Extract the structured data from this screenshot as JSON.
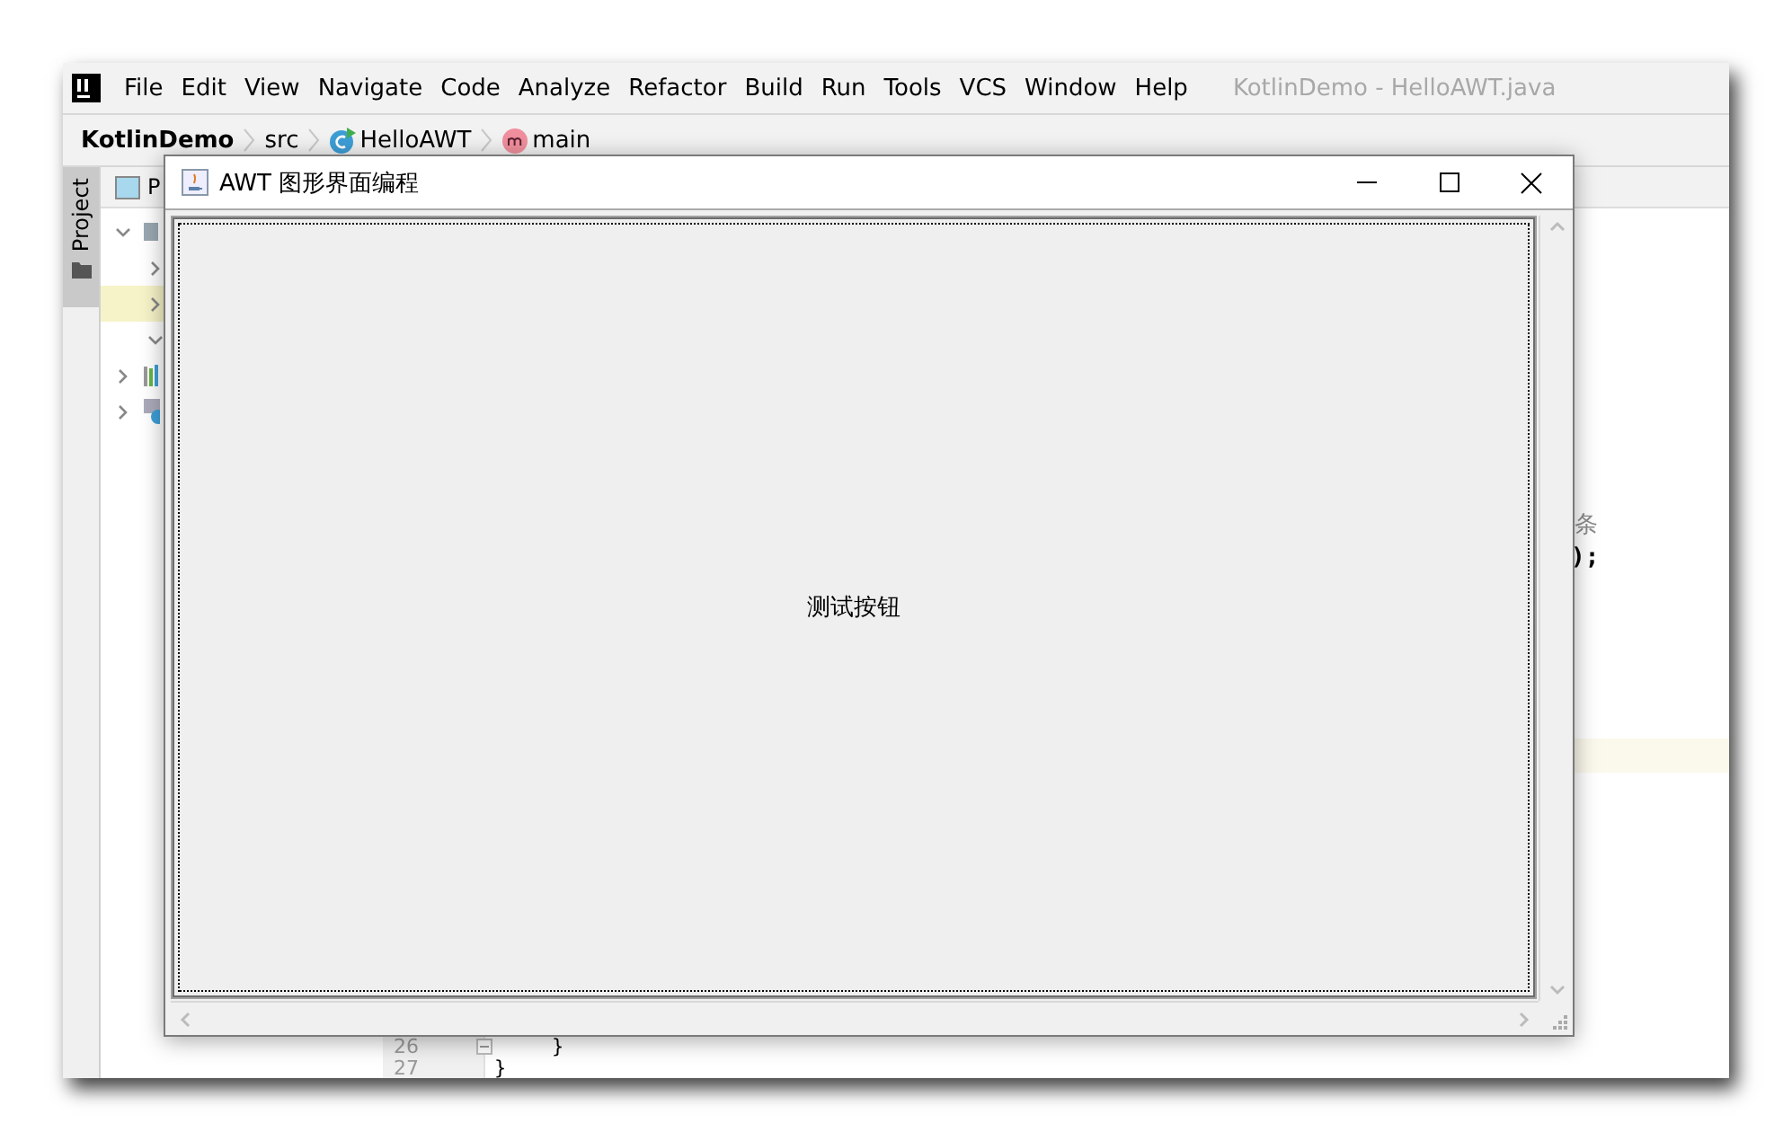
{
  "ide": {
    "menu": [
      {
        "label": "File"
      },
      {
        "label": "Edit"
      },
      {
        "label": "View"
      },
      {
        "label": "Navigate"
      },
      {
        "label": "Code"
      },
      {
        "label": "Analyze"
      },
      {
        "label": "Refactor"
      },
      {
        "label": "Build"
      },
      {
        "label": "Run"
      },
      {
        "label": "Tools"
      },
      {
        "label": "VCS"
      },
      {
        "label": "Window"
      },
      {
        "label": "Help"
      }
    ],
    "title": "KotlinDemo - HelloAWT.java",
    "breadcrumb": [
      {
        "label": "KotlinDemo",
        "kind": "project"
      },
      {
        "label": "src",
        "kind": "folder"
      },
      {
        "label": "HelloAWT",
        "kind": "class"
      },
      {
        "label": "main",
        "kind": "method"
      }
    ],
    "tool_window_tab": {
      "label": "Project",
      "selected": true
    },
    "project_panel": {
      "title": "P",
      "tree": [
        {
          "expanded": true,
          "selected": false,
          "children": [
            {
              "expanded": false,
              "selected": false
            },
            {
              "expanded": false,
              "selected": true
            },
            {
              "expanded": true,
              "selected": false
            }
          ]
        },
        {
          "expanded": false,
          "selected": false,
          "kind": "libraries"
        },
        {
          "expanded": false,
          "selected": false,
          "kind": "scratches"
        }
      ]
    },
    "editor": {
      "fragments": [
        {
          "text": "条",
          "kind": "comment"
        },
        {
          "text": ");",
          "kind": "code"
        }
      ],
      "lines": [
        {
          "number": "26",
          "code": "}",
          "foldable": true
        },
        {
          "number": "27",
          "code": "}",
          "foldable": false
        }
      ]
    }
  },
  "dialog": {
    "title": "AWT 图形界面编程",
    "button": {
      "label": "测试按钮",
      "focused": true
    }
  }
}
